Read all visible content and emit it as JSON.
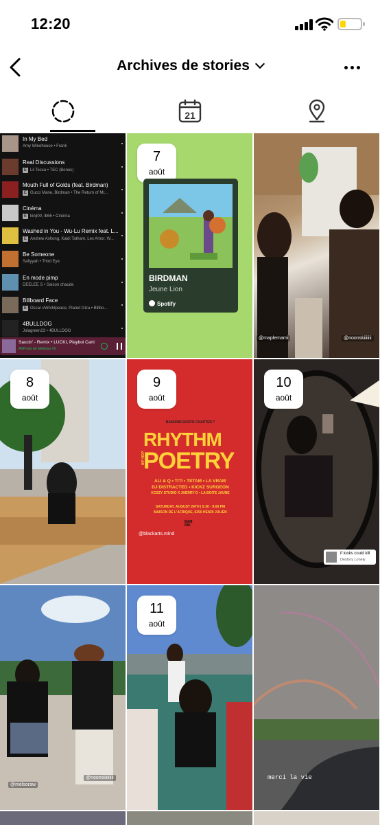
{
  "status_bar": {
    "time": "12:20"
  },
  "header": {
    "title": "Archives de stories"
  },
  "tabs": [
    {
      "name": "stories",
      "icon": "circle-dashed-icon",
      "active": true
    },
    {
      "name": "calendar",
      "icon": "calendar-icon",
      "day": "21",
      "active": false
    },
    {
      "name": "map",
      "icon": "location-pin-icon",
      "active": false
    }
  ],
  "playlist": {
    "tracks": [
      {
        "title": "In My Bed",
        "artist": "Amy Winehouse • Frank",
        "explicit": false,
        "color": "#a8958a"
      },
      {
        "title": "Real Discussions",
        "artist": "Lil Tecca • TEC (Bonus)",
        "explicit": true,
        "color": "#6b3c2e"
      },
      {
        "title": "Mouth Full of Golds (feat. Birdman)",
        "artist": "Gucci Mane, Birdman • The Return of Mr...",
        "explicit": true,
        "color": "#8a2020"
      },
      {
        "title": "Cinéma",
        "artist": "kinji00, lb66 • Cinéma",
        "explicit": true,
        "color": "#c8c8c8"
      },
      {
        "title": "Washed in You - Wu-Lu Remix feat. L...",
        "artist": "Andrew Ashong, Kaidi Tatham, Lex Amor, W...",
        "explicit": true,
        "color": "#e0c040"
      },
      {
        "title": "Be Someone",
        "artist": "Safiyyah • Third Eye",
        "explicit": false,
        "color": "#c07030"
      },
      {
        "title": "En mode pimp",
        "artist": "DEELEE S • Saison chaude",
        "explicit": false,
        "color": "#6090b0"
      },
      {
        "title": "Billboard Face",
        "artist": "Oscar #Worldpeace, Planet Giza • Billbo...",
        "explicit": true,
        "color": "#7a6a5a"
      },
      {
        "title": "4BULLDOG",
        "artist": "Jolagreen23 • 4BULLDOG",
        "explicit": false,
        "color": "#222222"
      }
    ],
    "now_playing": {
      "title": "Saucin' - Remix • LUCKI, Playboi Carti",
      "device": "AirPods de Melissa #2"
    }
  },
  "stories": [
    {
      "day": "7",
      "month": "août"
    },
    {
      "day": "8",
      "month": "août"
    },
    {
      "day": "9",
      "month": "août"
    },
    {
      "day": "10",
      "month": "août"
    },
    {
      "day": "11",
      "month": "août"
    }
  ],
  "album": {
    "title": "BIRDMAN",
    "artist": "Jeune Lion",
    "service": "Spotify"
  },
  "poster": {
    "top": "BAMJIND EKSPO CHAPTER 7",
    "title1": "RHYTHM",
    "title2": "POETRY",
    "side": "HIP HOP",
    "line1": "ALI & Q • TITI • TETAM • LA VRAIE",
    "line2": "DJ DISTRACTED • KICKZ SURGEON",
    "line3": "KOZZY STUDIO X JHERRY D • LA BOITE JAUNE",
    "date": "SATURDAY, AUGUST 24TH | 5:30 - 9:00 PM",
    "venue": "MAISON DE L'AFRIQUE, 6250 HENRI JULIEN",
    "logo": "BAM IND",
    "handle": "@blackarts.mind"
  },
  "handles": {
    "maple": "@maplemami",
    "noons_top": "@noonskiiiiiii",
    "melso": "@melsoraw",
    "noons_bottom": "@noonskiiiiiii"
  },
  "lyric": {
    "title": "if looks could kill",
    "artist": "Destroy Lonely"
  },
  "caption_rainbow": "merci la vie",
  "colors": {
    "spotify_green": "#1db954",
    "album_bg": "#a6d86e",
    "poster_red": "#d42c2c"
  }
}
